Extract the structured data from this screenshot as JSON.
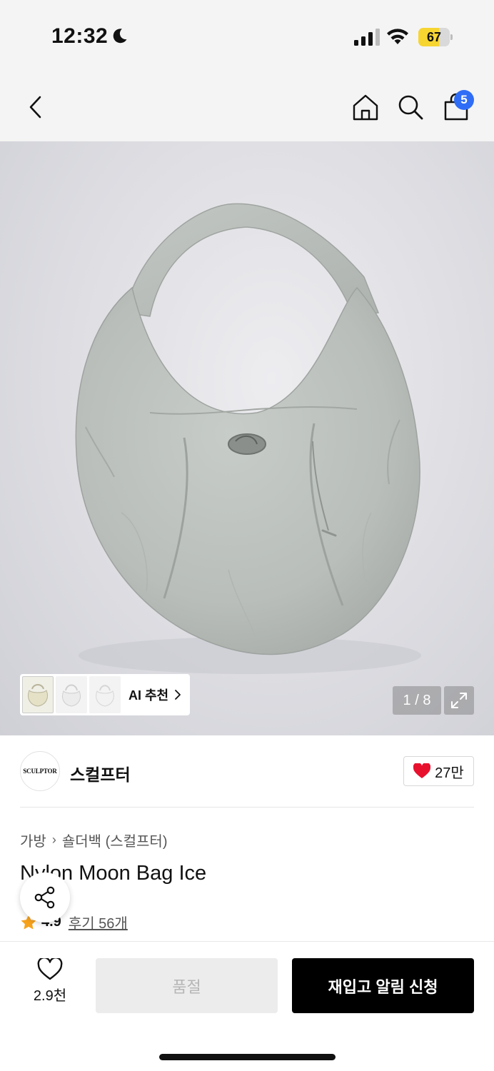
{
  "status_bar": {
    "time": "12:32",
    "battery_level": "67",
    "battery_fraction": 0.67,
    "icons": [
      "moon-icon",
      "signal-icon",
      "wifi-icon",
      "battery-icon"
    ]
  },
  "nav": {
    "icons": [
      "chevron-left-icon",
      "home-icon",
      "search-icon",
      "shopping-bag-icon"
    ],
    "cart_badge": "5"
  },
  "gallery": {
    "ai_label": "AI 추천",
    "counter": "1 / 8",
    "icons": [
      "expand-icon"
    ]
  },
  "brand": {
    "logo_text": "SCULPTOR",
    "name": "스컬프터",
    "like_count": "27만"
  },
  "product": {
    "breadcrumb": [
      "가방",
      "숄더백 (스컬프터)"
    ],
    "title": "Nylon Moon Bag Ice",
    "rating": "4.9",
    "review_link": "후기 56개"
  },
  "bottom": {
    "wish_count": "2.9천",
    "soldout_label": "품절",
    "restock_label": "재입고 알림 신청"
  },
  "colors": {
    "accent_badge": "#2f6df6",
    "battery": "#f7d531",
    "heart": "#e8112d",
    "star": "#f7a21b",
    "primary_button": "#000000"
  }
}
